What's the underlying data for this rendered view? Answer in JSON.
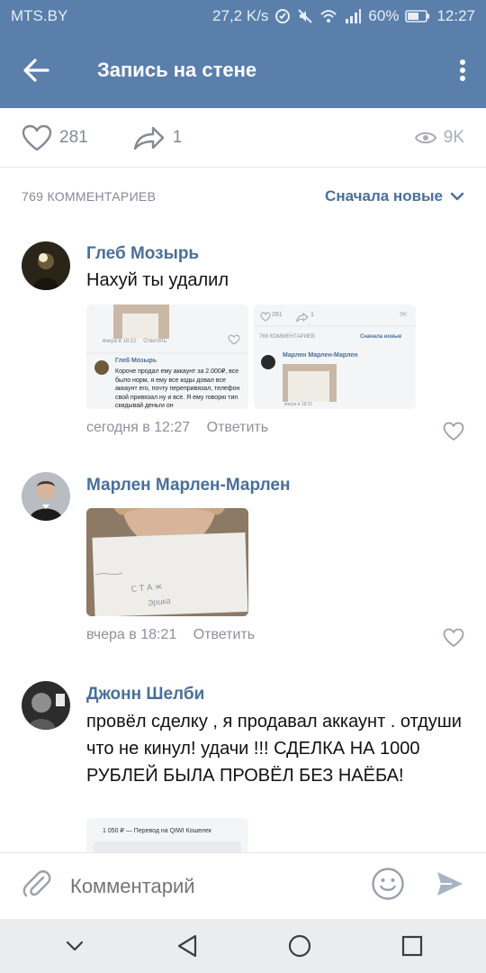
{
  "status_bar": {
    "carrier": "MTS.BY",
    "speed": "27,2 K/s",
    "battery": "60%",
    "time": "12:27"
  },
  "app_bar": {
    "title": "Запись на стене"
  },
  "stats": {
    "likes": "281",
    "shares": "1",
    "views": "9K"
  },
  "comments_header": {
    "count_label": "769 КОММЕНТАРИЕВ",
    "sort_label": "Сначала новые"
  },
  "comments": [
    {
      "author": "Глеб Мозырь",
      "text": "Нахуй ты удалил",
      "time": "сегодня в 12:27",
      "reply": "Ответить",
      "attachments": [
        {
          "inner_time": "вчера в 18:21",
          "inner_reply": "Ответить",
          "inner_author": "Глеб Мозырь",
          "inner_text": "Короче продал ему аккаунт за 2.000₽, все было норм, я ему все коды довал все аккаунт его, почту перепривязал, телефон свой привязал ну и все. Я ему говорю тип скидывай деньги он"
        },
        {
          "inner_likes": "281",
          "inner_shares": "1",
          "inner_views": "9K",
          "inner_count": "769 КОММЕНТАРИЕВ",
          "inner_sort": "Сначала новые",
          "inner_author": "Марлен Марлен-Марлен",
          "inner_time": "вчера в 18:21"
        }
      ]
    },
    {
      "author": "Марлен Марлен-Марлен",
      "time": "вчера в 18:21",
      "reply": "Ответить",
      "photo_caption": "Эрика"
    },
    {
      "author": "Джонн Шелби",
      "text": "провёл сделку , я продавал аккаунт . отдуши что не кинул! удачи !!! СДЕЛКА НА 1000 РУБЛЕЙ БЫЛА ПРОВЁЛ БЕЗ НАЁБА!",
      "attachment_text": "1 050 ₽ — Перевод на QIWI Кошелек"
    }
  ],
  "composer": {
    "placeholder": "Комментарий"
  },
  "colors": {
    "brand": "#5a7fab",
    "link": "#4a6f9a"
  }
}
